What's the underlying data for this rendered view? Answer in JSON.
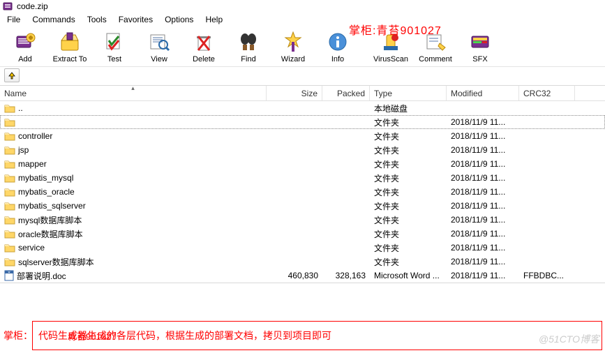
{
  "titlebar": {
    "text": "code.zip"
  },
  "menu": {
    "file": "File",
    "commands": "Commands",
    "tools": "Tools",
    "favorites": "Favorites",
    "options": "Options",
    "help": "Help"
  },
  "toolbar": {
    "add": "Add",
    "extract": "Extract To",
    "test": "Test",
    "view": "View",
    "delete": "Delete",
    "find": "Find",
    "wizard": "Wizard",
    "info": "Info",
    "virus": "VirusScan",
    "comment": "Comment",
    "sfx": "SFX"
  },
  "columns": {
    "name": "Name",
    "size": "Size",
    "packed": "Packed",
    "type": "Type",
    "modified": "Modified",
    "crc": "CRC32"
  },
  "rows": [
    {
      "name": "..",
      "type": "本地磁盘",
      "modified": "",
      "kind": "parent"
    },
    {
      "name": "",
      "type": "文件夹",
      "modified": "2018/11/9 11...",
      "kind": "folder",
      "selected": true
    },
    {
      "name": "controller",
      "type": "文件夹",
      "modified": "2018/11/9 11...",
      "kind": "folder"
    },
    {
      "name": "jsp",
      "type": "文件夹",
      "modified": "2018/11/9 11...",
      "kind": "folder"
    },
    {
      "name": "mapper",
      "type": "文件夹",
      "modified": "2018/11/9 11...",
      "kind": "folder"
    },
    {
      "name": "mybatis_mysql",
      "type": "文件夹",
      "modified": "2018/11/9 11...",
      "kind": "folder"
    },
    {
      "name": "mybatis_oracle",
      "type": "文件夹",
      "modified": "2018/11/9 11...",
      "kind": "folder"
    },
    {
      "name": "mybatis_sqlserver",
      "type": "文件夹",
      "modified": "2018/11/9 11...",
      "kind": "folder"
    },
    {
      "name": "mysql数据库脚本",
      "type": "文件夹",
      "modified": "2018/11/9 11...",
      "kind": "folder"
    },
    {
      "name": "oracle数据库脚本",
      "type": "文件夹",
      "modified": "2018/11/9 11...",
      "kind": "folder"
    },
    {
      "name": "service",
      "type": "文件夹",
      "modified": "2018/11/9 11...",
      "kind": "folder"
    },
    {
      "name": "sqlserver数据库脚本",
      "type": "文件夹",
      "modified": "2018/11/9 11...",
      "kind": "folder"
    },
    {
      "name": "部署说明.doc",
      "size": "460,830",
      "packed": "328,163",
      "type": "Microsoft Word ...",
      "modified": "2018/11/9 11...",
      "crc": "FFBDBC...",
      "kind": "doc"
    }
  ],
  "overlay": {
    "top": "掌柜:青苔901027",
    "footer_label": "掌柜：",
    "footer_overlay": "青苔901027",
    "footer_text": "代码生成器生成的各层代码，根据生成的部署文档，拷贝到项目即可"
  },
  "watermark": "@51CTO博客"
}
